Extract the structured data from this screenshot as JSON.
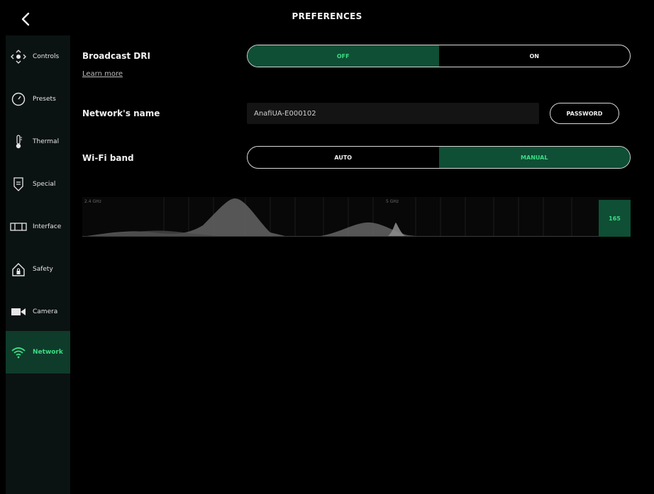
{
  "header": {
    "title": "PREFERENCES"
  },
  "sidebar": {
    "items": [
      {
        "label": "Controls",
        "icon": "dpad-icon",
        "active": false
      },
      {
        "label": "Presets",
        "icon": "gauge-icon",
        "active": false
      },
      {
        "label": "Thermal",
        "icon": "thermometer-icon",
        "active": false
      },
      {
        "label": "Special",
        "icon": "shield-icon",
        "active": false
      },
      {
        "label": "Interface",
        "icon": "battery-layout-icon",
        "active": false
      },
      {
        "label": "Safety",
        "icon": "home-lock-icon",
        "active": false
      },
      {
        "label": "Camera",
        "icon": "video-camera-icon",
        "active": false
      },
      {
        "label": "Network",
        "icon": "wifi-icon",
        "active": true
      }
    ]
  },
  "broadcast": {
    "label": "Broadcast DRI",
    "learn_more": "Learn more",
    "options": [
      "OFF",
      "ON"
    ],
    "selected": "OFF"
  },
  "network": {
    "label": "Network's name",
    "value": "AnafiUA-E000102",
    "password_button": "PASSWORD"
  },
  "wifi_band": {
    "label": "Wi-Fi band",
    "options": [
      "AUTO",
      "MANUAL"
    ],
    "selected": "MANUAL"
  },
  "spectrum": {
    "label_left": "2.4 GHz",
    "label_mid": "5 GHz",
    "channel_marker": "6",
    "selected_channel": "165"
  },
  "colors": {
    "accent": "#3ddc84",
    "accent_bg": "#0f4f35",
    "sidebar_bg": "#0b1212"
  }
}
